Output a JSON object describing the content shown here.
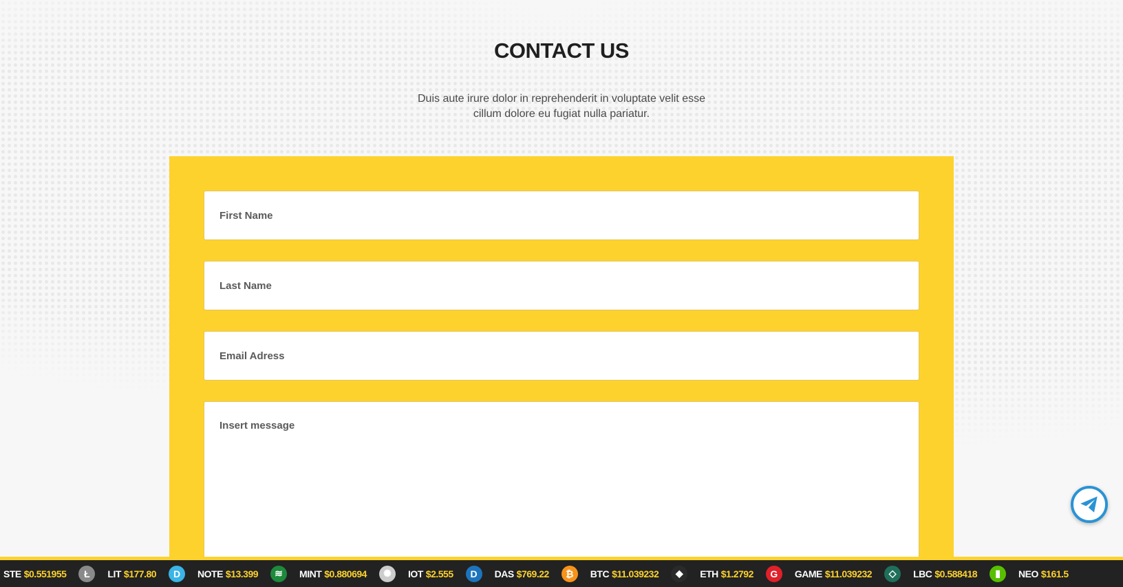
{
  "header": {
    "title": "CONTACT US",
    "subtitle": "Duis aute irure dolor in reprehenderit in voluptate velit esse cillum dolore eu fugiat nulla pariatur."
  },
  "form": {
    "first_name_placeholder": "First Name",
    "last_name_placeholder": "Last Name",
    "email_placeholder": "Email Adress",
    "message_placeholder": "Insert message"
  },
  "ticker": {
    "items": [
      {
        "symbol": "STE",
        "price": "$0.551955",
        "icon": "none",
        "color": ""
      },
      {
        "symbol": "LIT",
        "price": "$177.80",
        "icon": "litecoin-icon",
        "color": "#8a8a8a"
      },
      {
        "symbol": "NOTE",
        "price": "$13.399",
        "icon": "dnotes-icon",
        "color": "#3bb4e6"
      },
      {
        "symbol": "MINT",
        "price": "$0.880694",
        "icon": "mint-icon",
        "color": "#1e8a3c"
      },
      {
        "symbol": "IOT",
        "price": "$2.555",
        "icon": "iota-icon",
        "color": "#cccccc"
      },
      {
        "symbol": "DAS",
        "price": "$769.22",
        "icon": "dash-icon",
        "color": "#1c75bc"
      },
      {
        "symbol": "BTC",
        "price": "$11.039232",
        "icon": "bitcoin-icon",
        "color": "#f7931a"
      },
      {
        "symbol": "ETH",
        "price": "$1.2792",
        "icon": "ethereum-icon",
        "color": "#2a2a2a"
      },
      {
        "symbol": "GAME",
        "price": "$11.039232",
        "icon": "gamecredits-icon",
        "color": "#e0202a"
      },
      {
        "symbol": "LBC",
        "price": "$0.588418",
        "icon": "lbry-icon",
        "color": "#1f6f5a"
      },
      {
        "symbol": "NEO",
        "price": "$161.5",
        "icon": "neo-icon",
        "color": "#58bf00"
      }
    ]
  },
  "colors": {
    "accent": "#fdd22d",
    "background": "#f7f7f7",
    "ticker_bg": "#222222",
    "telegram": "#2a93d4"
  },
  "floating": {
    "icon": "telegram-icon"
  }
}
